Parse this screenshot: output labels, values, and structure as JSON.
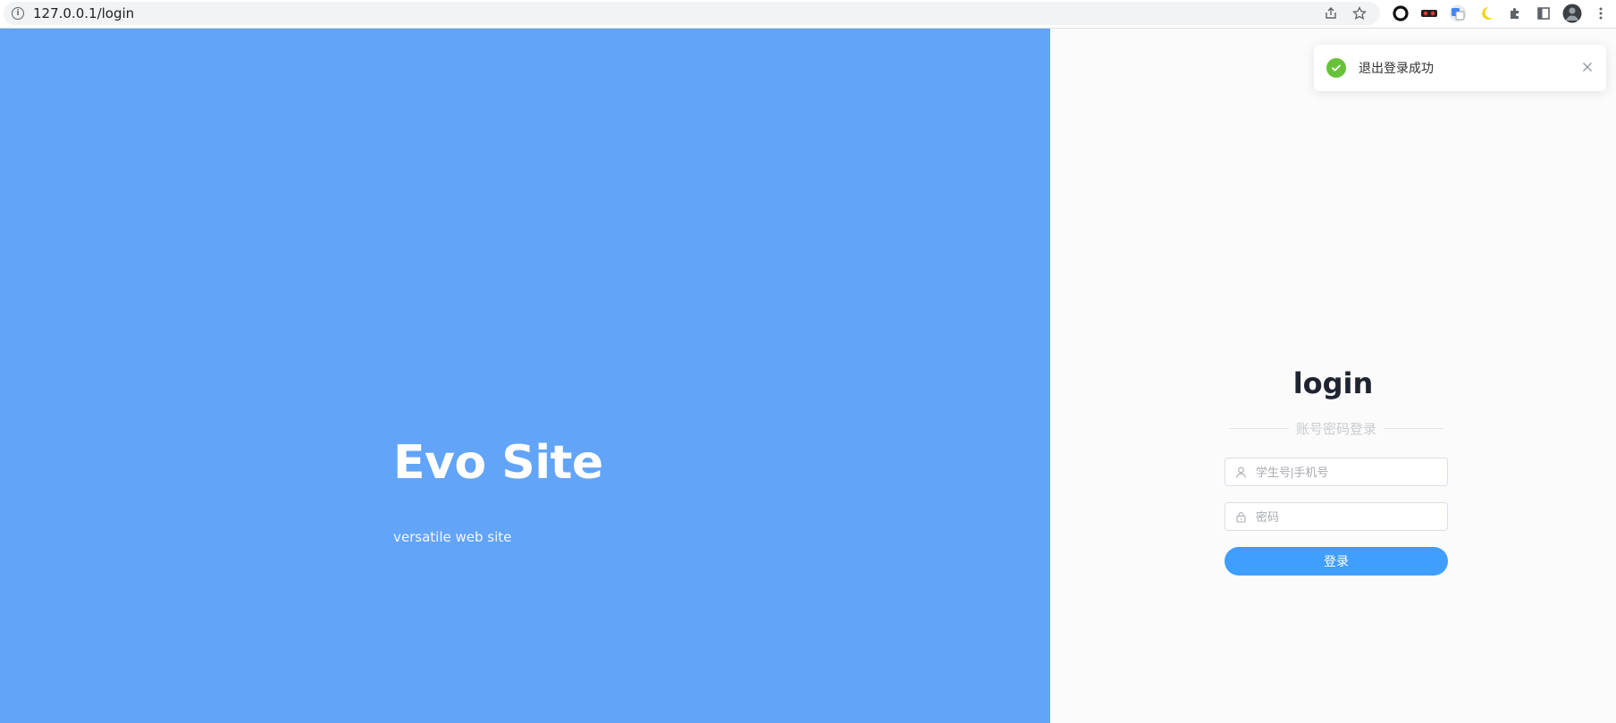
{
  "browser": {
    "url": "127.0.0.1/login",
    "icons": [
      "info-icon",
      "share-icon",
      "star-icon",
      "extension-icons",
      "puzzle-icon",
      "sidepanel-icon",
      "profile-avatar",
      "menu-icon"
    ]
  },
  "hero": {
    "title": "Evo Site",
    "subtitle": "versatile web site",
    "background_color": "#62a4f8"
  },
  "login": {
    "title": "login",
    "divider_text": "账号密码登录",
    "username_placeholder": "学生号|手机号",
    "password_placeholder": "密码",
    "submit_label": "登录",
    "accent_color": "#409eff"
  },
  "toast": {
    "message": "退出登录成功",
    "status": "success",
    "status_color": "#67c23a"
  }
}
